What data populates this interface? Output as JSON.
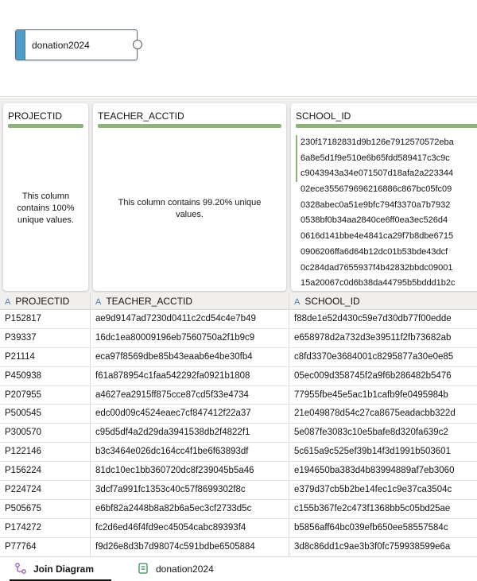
{
  "diagram": {
    "node_label": "donation2024"
  },
  "profile": {
    "cards": [
      {
        "title": "PROJECTID",
        "message": "This column contains 100% unique values."
      },
      {
        "title": "TEACHER_ACCTID",
        "message": "This column contains 99.20% unique values."
      },
      {
        "title": "SCHOOL_ID",
        "values": [
          "230f17182831d9b126e7912570572eba",
          "6a8e5d1f9e510e6b65fdd589417c3c9c",
          "c9043943a34e071507d18afa2a223344",
          "02ece355679696216886c867bc05fc09",
          "0328abec0a51e9bfc794f3370a7b7932",
          "0538bf0b34aa2840ce6ff0ea3ec526d4",
          "0616d141bbe4e4841ca29f7b8dbe6715",
          "0906206ffa6d64b12dc01b53bde43dcf",
          "0c284dad7655937f4b42832bbdc09001",
          "15a20067c0d6b38da44795b5bddd1b2c"
        ]
      }
    ]
  },
  "table": {
    "type_glyph": "A",
    "columns": [
      "PROJECTID",
      "TEACHER_ACCTID",
      "SCHOOL_ID"
    ],
    "rows": [
      [
        "P152817",
        "ae9d9147ad7230d0411c2cd54c4e7b49",
        "f88de1e52d430c59e7d30db77f00edde"
      ],
      [
        "P39337",
        "16dc1ea80009196eb7560750a2f1b9c9",
        "e658978d2a732d3e39511f2fb73682ab"
      ],
      [
        "P21114",
        "eca97f8569dbe85b43eaab6e4be30fb4",
        "c8fd3370e3684001c8295877a30e0e85"
      ],
      [
        "P450938",
        "f61a878954c1faa542292fa0921b1808",
        "05ec009d358745f2a9f6b286482b5476"
      ],
      [
        "P207955",
        "a4627ea2915ff875cce87cd5f33e4734",
        "77955fbe45e5ac1b1cafb9fe0495984b"
      ],
      [
        "P500545",
        "edc00d09c4524eaec7cf847412f22a37",
        "21e049878d54c27ca8675eadacbb322d"
      ],
      [
        "P300570",
        "c95d5df4a2d29da3941538db2f4822f1",
        "5e087fe3083c10e5bafe8d320fa639c2"
      ],
      [
        "P122146",
        "b3c3464e026dc164cc4f1be6f63893df",
        "5c615a9c525ef39b14f3d1991b503601"
      ],
      [
        "P156224",
        "81dc10ec1bb360720dc8f239045b5a46",
        "e194650ba383d4b83994889af7eb3060"
      ],
      [
        "P224724",
        "3dcf7a991fc1353c40c57f8699302f8c",
        "e379d37cb5b2be14fec1c9e37ca3504c"
      ],
      [
        "P505675",
        "e6bf82a2448b8a82b6a5ec3cf2733d5c",
        "c155b367fe2c473f1368bb5c05bd25ae"
      ],
      [
        "P174272",
        "fc2d6ed46f4fd9ec45054cabc89393f4",
        "b5856aff64bc039efb650ee58557584c"
      ],
      [
        "P77764",
        "f9d26e8d3b7d98074c591bdbe6505884",
        "3d8c86dd1c9ae3b3f0fc759938599e6a"
      ]
    ]
  },
  "tabs": [
    {
      "label": "Join Diagram",
      "icon": "join-diagram-icon",
      "active": true
    },
    {
      "label": "donation2024",
      "icon": "dataset-icon",
      "active": false
    }
  ],
  "colors": {
    "accent": "#4f9cc8",
    "quality_bar": "#8bb37a",
    "type_glyph": "#4f7fae"
  }
}
